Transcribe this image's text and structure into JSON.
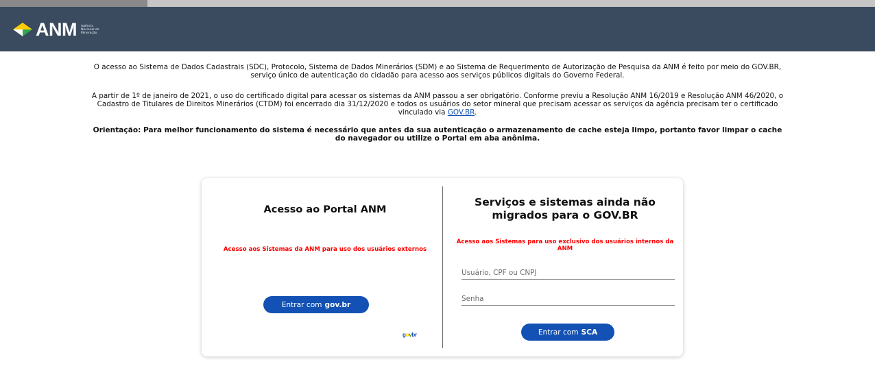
{
  "header": {
    "logo_text": "ANM",
    "logo_subtitle": "Agência Nacional de Mineração"
  },
  "intro": {
    "p1": "O acesso ao Sistema de Dados Cadastrais (SDC), Protocolo, Sistema de Dados Minerários (SDM) e ao Sistema de Requerimento de Autorização de Pesquisa da ANM é feito por meio do GOV.BR, serviço único de autenticação do cidadão para acesso aos serviços públicos digitais do Governo Federal.",
    "p2_text": "A partir de 1º de janeiro de 2021, o uso do certificado digital para acessar os sistemas da ANM passou a ser obrigatório. Conforme previu a Resolução ANM 16/2019 e Resolução ANM 46/2020, o Cadastro de Titulares de Direitos Minerários (CTDM) foi encerrado dia 31/12/2020 e todos os usuários do setor mineral que precisam acessar os serviços da agência precisam ter o certificado vinculado via ",
    "p2_link": "GOV.BR",
    "p2_end": ".",
    "p3": "Orientação: Para melhor funcionamento do sistema é necessário que antes da sua autenticação o armazenamento de cache esteja limpo, portanto favor limpar o cache do navegador ou utilize o Portal em aba anônima."
  },
  "left": {
    "title": "Acesso ao Portal ANM",
    "notice": "Acesso aos Sistemas da ANM para uso dos usuários externos",
    "button_prefix": "Entrar com",
    "button_strong": "gov.br",
    "govbr_logo": {
      "g": "g",
      "o": "o",
      "v": "v",
      "br": "br"
    }
  },
  "right": {
    "title": "Serviços e sistemas ainda não migrados para o GOV.BR",
    "notice": "Acesso aos Sistemas para uso exclusivo dos usuários internos da ANM",
    "user_placeholder": "Usuário, CPF ou CNPJ",
    "pass_placeholder": "Senha",
    "button_prefix": "Entrar com",
    "button_strong": "SCA"
  },
  "colors": {
    "header_bg": "#3a4b60",
    "button_blue": "#1351b4",
    "notice_red": "#ff0000"
  }
}
